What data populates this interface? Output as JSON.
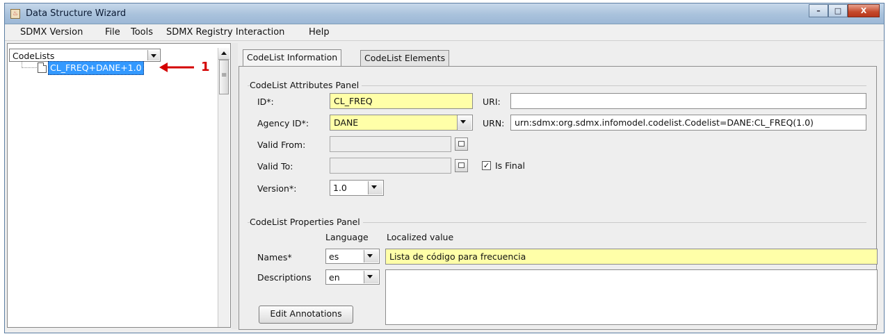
{
  "window": {
    "title": "Data Structure Wizard",
    "min_glyph": "–",
    "max_glyph": "□",
    "close_glyph": "X"
  },
  "menubar": [
    "SDMX Version",
    "File",
    "Tools",
    "SDMX Registry Interaction",
    "Help"
  ],
  "left": {
    "combo_value": "CodeLists",
    "tree_node": "CL_FREQ+DANE+1.0",
    "callout_number": "1"
  },
  "tabs": [
    "CodeList Information",
    "CodeList Elements"
  ],
  "attributes_panel": {
    "title": "CodeList Attributes Panel",
    "id_label": "ID*:",
    "id_value": "CL_FREQ",
    "uri_label": "URI:",
    "uri_value": "",
    "agency_label": "Agency ID*:",
    "agency_value": "DANE",
    "urn_label": "URN:",
    "urn_value": "urn:sdmx:org.sdmx.infomodel.codelist.Codelist=DANE:CL_FREQ(1.0)",
    "valid_from_label": "Valid From:",
    "valid_to_label": "Valid To:",
    "is_final_label": "Is Final",
    "is_final_checked": true,
    "version_label": "Version*:",
    "version_value": "1.0"
  },
  "properties_panel": {
    "title": "CodeList Properties Panel",
    "language_header": "Language",
    "localized_header": "Localized value",
    "names_label": "Names*",
    "names_lang": "es",
    "names_value": "Lista de código para frecuencia",
    "descriptions_label": "Descriptions",
    "descriptions_lang": "en",
    "edit_annotations": "Edit Annotations"
  },
  "colors": {
    "required_field": "#ffffa8",
    "selection": "#3399ff",
    "callout": "#d40000"
  }
}
